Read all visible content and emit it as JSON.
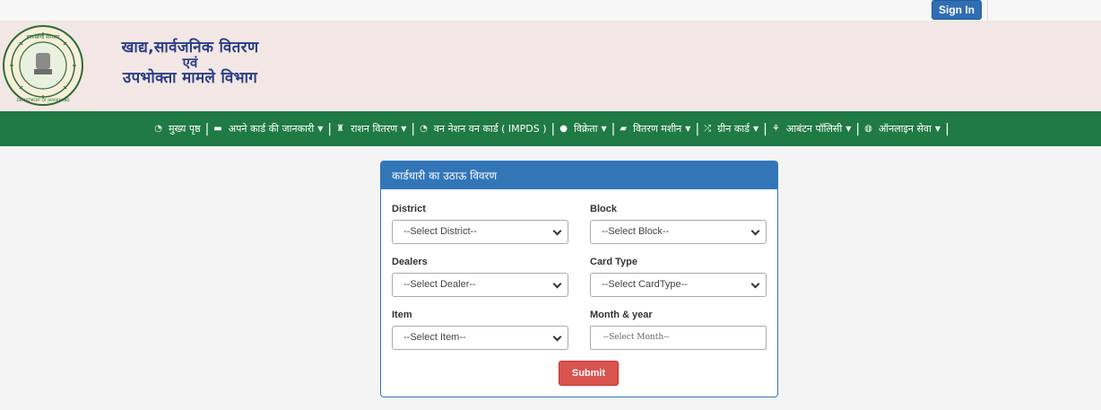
{
  "top": {
    "signin_label": "Sign In"
  },
  "header": {
    "title_line1": "खाद्य,सार्वजनिक वितरण",
    "title_line2": "एवं",
    "title_line3": "उपभोक्ता मामले विभाग",
    "logo_text_top": "झारखण्ड सरकार",
    "logo_text_bottom": "DEPARTMENT OF JHARKHAND"
  },
  "nav": {
    "items": [
      {
        "label": "मुख्य पृष्ठ",
        "icon": "dashboard-icon",
        "dropdown": false
      },
      {
        "label": "अपने कार्ड की जानकारी",
        "icon": "card-icon",
        "dropdown": true
      },
      {
        "label": "राशन वितरण",
        "icon": "user-tie-icon",
        "dropdown": true
      },
      {
        "label": "वन नेशन वन कार्ड ( IMPDS )",
        "icon": "dashboard-icon",
        "dropdown": false
      },
      {
        "label": "विक्रेता",
        "icon": "user-icon",
        "dropdown": true
      },
      {
        "label": "वितरण मशीन",
        "icon": "laptop-icon",
        "dropdown": true
      },
      {
        "label": "ग्रीन कार्ड",
        "icon": "random-icon",
        "dropdown": true
      },
      {
        "label": "आबंटन पॉलिसी",
        "icon": "leaf-icon",
        "dropdown": true
      },
      {
        "label": "ऑनलाइन सेवा",
        "icon": "globe-icon",
        "dropdown": true
      }
    ]
  },
  "panel": {
    "heading": "कार्डधारी का उठाऊ विवरण",
    "district_label": "District",
    "district_value": "--Select District--",
    "block_label": "Block",
    "block_value": "--Select Block--",
    "dealers_label": "Dealers",
    "dealers_value": "--Select Dealer--",
    "cardtype_label": "Card Type",
    "cardtype_value": "--Select CardType--",
    "item_label": "Item",
    "item_value": "--Select Item--",
    "month_label": "Month & year",
    "month_placeholder": "--Select Month--",
    "submit_label": "Submit"
  },
  "colors": {
    "nav_bg": "#1f7a44",
    "header_bg": "#f2e7e5",
    "panel_accent": "#3276b8",
    "submit_bg": "#d9534f",
    "signin_bg": "#2f6db5",
    "title_color": "#2c3d86"
  }
}
